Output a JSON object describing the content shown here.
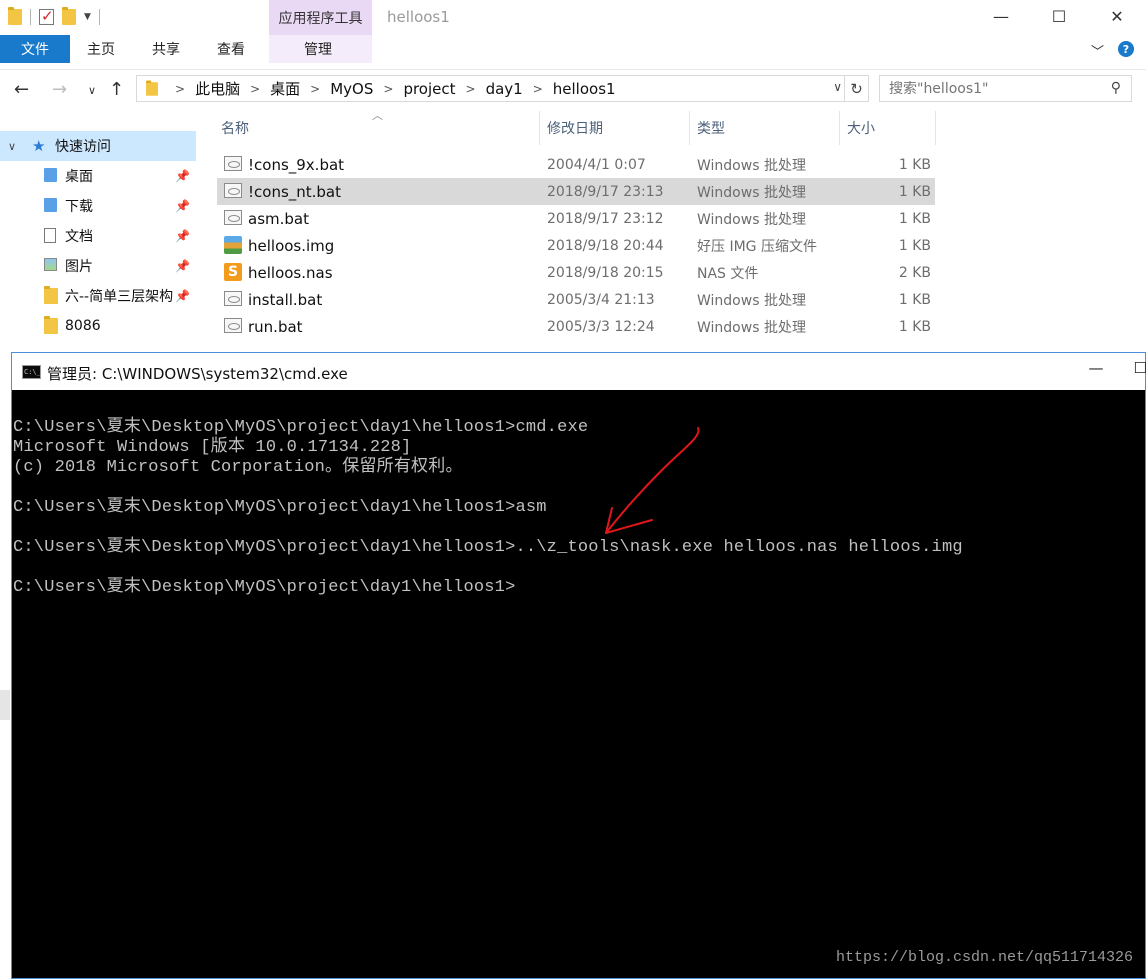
{
  "explorer": {
    "title": "helloos1",
    "contextual_tab_group": "应用程序工具",
    "ribbon_tabs": [
      "文件",
      "主页",
      "共享",
      "查看",
      "管理"
    ],
    "window_controls": [
      "—",
      "☐",
      "✕"
    ],
    "breadcrumb": [
      "此电脑",
      "桌面",
      "MyOS",
      "project",
      "day1",
      "helloos1"
    ],
    "search_placeholder": "搜索\"helloos1\"",
    "nav_pane": {
      "quick_access": "快速访问",
      "items": [
        {
          "label": "桌面",
          "pinned": true,
          "icon": "desktop-folder-icon"
        },
        {
          "label": "下载",
          "pinned": true,
          "icon": "download-folder-icon"
        },
        {
          "label": "文档",
          "pinned": true,
          "icon": "document-icon"
        },
        {
          "label": "图片",
          "pinned": true,
          "icon": "picture-icon"
        },
        {
          "label": "六--简单三层架构",
          "pinned": true,
          "icon": "folder-icon"
        },
        {
          "label": "8086",
          "pinned": false,
          "icon": "folder-icon"
        }
      ]
    },
    "columns": {
      "name": "名称",
      "modified": "修改日期",
      "type": "类型",
      "size": "大小"
    },
    "files": [
      {
        "name": "!cons_9x.bat",
        "modified": "2004/4/1 0:07",
        "type": "Windows 批处理",
        "size": "1 KB",
        "icon": "bat",
        "selected": false
      },
      {
        "name": "!cons_nt.bat",
        "modified": "2018/9/17 23:13",
        "type": "Windows 批处理",
        "size": "1 KB",
        "icon": "bat",
        "selected": true
      },
      {
        "name": "asm.bat",
        "modified": "2018/9/17 23:12",
        "type": "Windows 批处理",
        "size": "1 KB",
        "icon": "bat",
        "selected": false
      },
      {
        "name": "helloos.img",
        "modified": "2018/9/18 20:44",
        "type": "好压 IMG 压缩文件",
        "size": "1 KB",
        "icon": "img",
        "selected": false
      },
      {
        "name": "helloos.nas",
        "modified": "2018/9/18 20:15",
        "type": "NAS 文件",
        "size": "2 KB",
        "icon": "nas",
        "selected": false
      },
      {
        "name": "install.bat",
        "modified": "2005/3/4 21:13",
        "type": "Windows 批处理",
        "size": "1 KB",
        "icon": "bat",
        "selected": false
      },
      {
        "name": "run.bat",
        "modified": "2005/3/3 12:24",
        "type": "Windows 批处理",
        "size": "1 KB",
        "icon": "bat",
        "selected": false
      }
    ]
  },
  "cmd": {
    "title": "管理员: C:\\WINDOWS\\system32\\cmd.exe",
    "icon_text": "C:\\_",
    "controls": [
      "—",
      "☐"
    ],
    "lines": [
      "C:\\Users\\夏末\\Desktop\\MyOS\\project\\day1\\helloos1>cmd.exe",
      "Microsoft Windows [版本 10.0.17134.228]",
      "(c) 2018 Microsoft Corporation。保留所有权利。",
      "",
      "C:\\Users\\夏末\\Desktop\\MyOS\\project\\day1\\helloos1>asm",
      "",
      "C:\\Users\\夏末\\Desktop\\MyOS\\project\\day1\\helloos1>..\\z_tools\\nask.exe helloos.nas helloos.img",
      "",
      "C:\\Users\\夏末\\Desktop\\MyOS\\project\\day1\\helloos1>"
    ],
    "annotation_color": "#e0161b"
  },
  "watermark": "https://blog.csdn.net/qq511714326"
}
